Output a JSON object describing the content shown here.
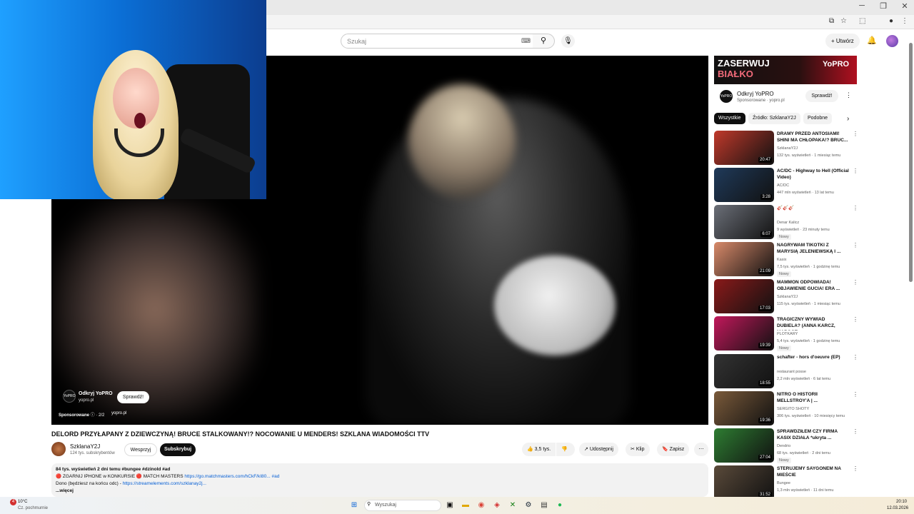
{
  "browser": {
    "window_controls": [
      "─",
      "❐",
      "✕"
    ]
  },
  "youtube": {
    "search_placeholder": "Szukaj",
    "create_label": "Utwórz"
  },
  "player_ad": {
    "name": "Odkryj YoPRO",
    "domain": "yopro.pl",
    "button": "Sprawdź!",
    "sponsored": "Sponsorowane",
    "counter": "2/2",
    "site": "yopro.pl"
  },
  "video": {
    "title": "DELORD PRZYŁAPANY Z DZIEWCZYNĄ! BRUCE STALKOWANY!? NOCOWANIE U MENDERS! SZKLANA WIADOMOŚCI TTV",
    "channel": "SzklanaY2J",
    "subscribers": "124 tys. subskrybentów",
    "support": "Wesprzyj",
    "subscribe": "Subskrybuj",
    "likes": "3,5 tys.",
    "share": "Udostępnij",
    "clip": "Klip",
    "save": "Zapisz"
  },
  "description": {
    "stats": "84 tys. wyświetleń  2 dni temu  #bungee #dzinold #ad",
    "line1_prefix": "🔴 ZGARNIJ IPHONE w KONKURSIE 🔴 MATCH MASTERS ",
    "line1_link": "https://go.matchmasters.com/hCkF/kI80...",
    "line1_tag": "#ad",
    "line2_prefix": "Dono (będziesz na końcu odc) - ",
    "line2_link": "https://streamelements.com/szklanay2j...",
    "more": "...więcej"
  },
  "sidebar_ad": {
    "banner_line1": "ZASERWUJ",
    "banner_line2": "BIAŁKO",
    "banner_brand": "YoPRO",
    "title": "Odkryj YoPRO",
    "sponsor": "Sponsorowane · yopro.pl",
    "button": "Sprawdź!"
  },
  "chips": [
    "Wszystkie",
    "Źródło: SzklanaY2J",
    "Podobne"
  ],
  "recommendations": [
    {
      "title": "DRAMY PRZED ANTOSIAMI! SHINI MA CHŁOPAKA!? BRUC...",
      "channel": "SzklanaY2J",
      "meta": "132 tys. wyświetleń · 1 miesiąc temu",
      "duration": "20:47",
      "badge": "",
      "color": "#c0392b"
    },
    {
      "title": "AC/DC - Highway to Hell (Official Video)",
      "channel": "AC/DC",
      "meta": "447 mln wyświetleń · 13 lat temu",
      "duration": "3:28",
      "badge": "",
      "color": "#1f3a5a"
    },
    {
      "title": "🎸🎸🎸",
      "channel": "Denar Kalicz",
      "meta": "9 wyświetleń · 23 minuty temu",
      "duration": "6:07",
      "badge": "Nowy",
      "color": "#6b6f78"
    },
    {
      "title": "NAGRYWAM TIKOTKI Z MARYSIĄ JELENIEWSKĄ I ...",
      "channel": "Kasix",
      "meta": "7,5 tys. wyświetleń · 1 godzinę temu",
      "duration": "21:09",
      "badge": "Nowy",
      "color": "#d98a6a"
    },
    {
      "title": "MAMMON ODPOWIADA! OBJAWIENIE GUCIA! ERA ...",
      "channel": "SzklanaY2J",
      "meta": "115 tys. wyświetleń · 1 miesiąc temu",
      "duration": "17:03",
      "badge": "",
      "color": "#8a1a1a"
    },
    {
      "title": "TRAGICZNY WYWIAD DUBIELA? (ANNA KARCZ, MARGOT ...",
      "channel": "PLOTKARY",
      "meta": "5,4 tys. wyświetleń · 1 godzinę temu",
      "duration": "19:39",
      "badge": "Nowy",
      "color": "#c2185b"
    },
    {
      "title": "schafter - hors d'oeuvre (EP)",
      "channel": "restaurant posse",
      "meta": "2,2 mln wyświetleń · 6 lat temu",
      "duration": "18:55",
      "badge": "",
      "color": "#333"
    },
    {
      "title": "NITRO O HISTORII MELLSTROY'A | ...",
      "channel": "SERGITO SHOTY",
      "meta": "306 tys. wyświetleń · 10 miesięcy temu",
      "duration": "19:36",
      "badge": "",
      "color": "#7a5a3a"
    },
    {
      "title": "SPRAWDZIŁEM CZY FIRMA KASIX DZIAŁA *ukryta ...",
      "channel": "Dendrio",
      "meta": "68 tys. wyświetleń · 2 dni temu",
      "duration": "27:04",
      "badge": "Nowy",
      "color": "#2e7d32"
    },
    {
      "title": "STERUJEMY SAYGONEM NA MIEŚCIE",
      "channel": "Bungee",
      "meta": "1,3 mln wyświetleń · 11 dni temu",
      "duration": "31:52",
      "badge": "",
      "color": "#5a4a3a"
    }
  ],
  "taskbar": {
    "weather_temp": "10°C",
    "weather_desc": "Cz. pochmurnie",
    "weather_badge": "4",
    "search": "Wyszukaj",
    "time": "20:10",
    "date": "12.03.2026"
  }
}
